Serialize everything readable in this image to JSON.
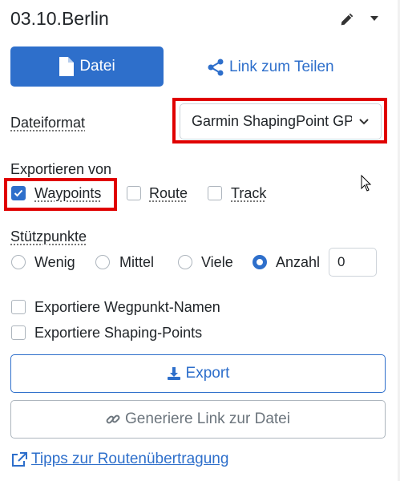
{
  "header": {
    "title": "03.10.Berlin"
  },
  "tabs": {
    "file_label": "Datei",
    "share_label": "Link zum Teilen"
  },
  "format": {
    "label": "Dateiformat",
    "selected": "Garmin ShapingPoint GPX"
  },
  "export_from": {
    "label": "Exportieren von",
    "options": [
      {
        "label": "Waypoints",
        "checked": true
      },
      {
        "label": "Route",
        "checked": false
      },
      {
        "label": "Track",
        "checked": false
      }
    ]
  },
  "support_points": {
    "label": "Stützpunkte",
    "options": [
      {
        "label": "Wenig",
        "selected": false
      },
      {
        "label": "Mittel",
        "selected": false
      },
      {
        "label": "Viele",
        "selected": false
      },
      {
        "label": "Anzahl",
        "selected": true
      }
    ],
    "count": "0"
  },
  "checkboxes": {
    "waypoint_names": "Exportiere Wegpunkt-Namen",
    "shaping_points": "Exportiere Shaping-Points"
  },
  "buttons": {
    "export": "Export",
    "generate_link": "Generiere Link zur Datei"
  },
  "tips_link": "Tipps zur Routenübertragung",
  "colors": {
    "accent": "#2e6fcb",
    "highlight": "#e00000"
  }
}
